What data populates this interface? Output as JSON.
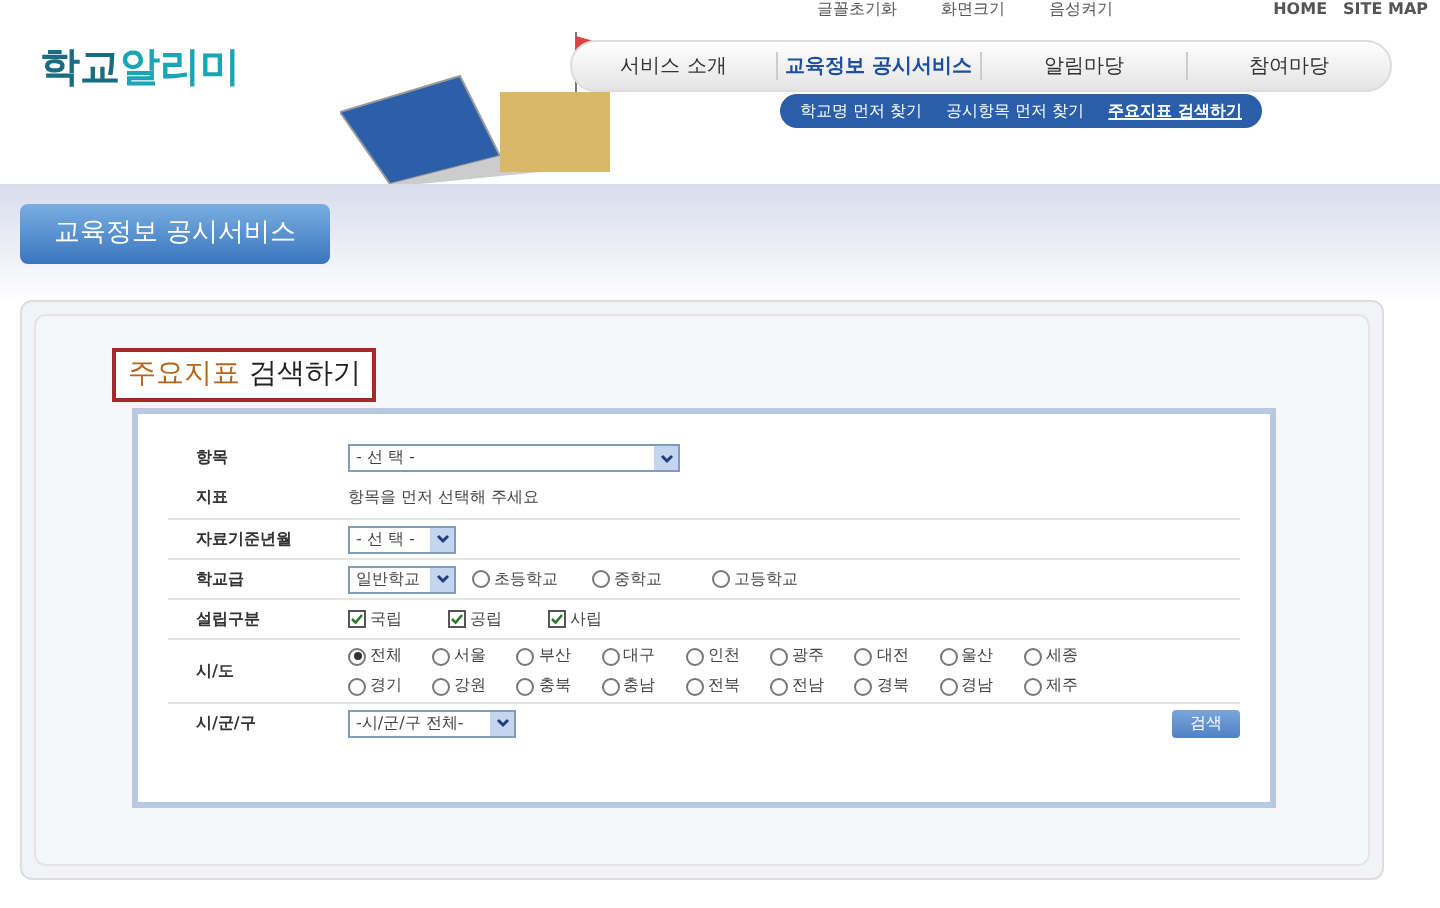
{
  "utility_links": [
    "글꼴초기화",
    "화면크기",
    "음성켜기"
  ],
  "top_links": [
    "HOME",
    "SITE MAP"
  ],
  "logo": {
    "part_1": "학교",
    "part_2": "알리미"
  },
  "main_nav": [
    {
      "label": "서비스 소개",
      "selected": false
    },
    {
      "label": "교육정보 공시서비스",
      "selected": true
    },
    {
      "label": "알림마당",
      "selected": false
    },
    {
      "label": "참여마당",
      "selected": false
    }
  ],
  "sub_nav": [
    {
      "label": "학교명 먼저 찾기",
      "selected": false
    },
    {
      "label": "공시항목 먼저 찾기",
      "selected": false
    },
    {
      "label": "주요지표 검색하기",
      "selected": true
    }
  ],
  "section_tab": "교육정보 공시서비스",
  "page_title": {
    "highlight": "주요지표",
    "rest": "검색하기"
  },
  "form": {
    "rows": [
      {
        "label": "항목",
        "kind": "select",
        "value": "- 선 택 -",
        "wide": true
      },
      {
        "label": "지표",
        "kind": "text",
        "text": "항목을 먼저 선택해 주세요"
      },
      {
        "label": "자료기준년월",
        "kind": "select",
        "value": "- 선 택 -",
        "wide": false
      },
      {
        "label": "학교급",
        "kind": "select_radios",
        "value": "일반학교",
        "options": [
          {
            "label": "초등학교",
            "selected": false
          },
          {
            "label": "중학교",
            "selected": false
          },
          {
            "label": "고등학교",
            "selected": false
          }
        ]
      },
      {
        "label": "설립구분",
        "kind": "checkboxes",
        "options": [
          {
            "label": "국립",
            "checked": true
          },
          {
            "label": "공립",
            "checked": true
          },
          {
            "label": "사립",
            "checked": true
          }
        ]
      },
      {
        "label": "시/도",
        "kind": "radios",
        "options": [
          {
            "label": "전체",
            "selected": true
          },
          {
            "label": "서울",
            "selected": false
          },
          {
            "label": "부산",
            "selected": false
          },
          {
            "label": "대구",
            "selected": false
          },
          {
            "label": "인천",
            "selected": false
          },
          {
            "label": "광주",
            "selected": false
          },
          {
            "label": "대전",
            "selected": false
          },
          {
            "label": "울산",
            "selected": false
          },
          {
            "label": "세종",
            "selected": false
          },
          {
            "label": "경기",
            "selected": false
          },
          {
            "label": "강원",
            "selected": false
          },
          {
            "label": "충북",
            "selected": false
          },
          {
            "label": "충남",
            "selected": false
          },
          {
            "label": "전북",
            "selected": false
          },
          {
            "label": "전남",
            "selected": false
          },
          {
            "label": "경북",
            "selected": false
          },
          {
            "label": "경남",
            "selected": false
          },
          {
            "label": "제주",
            "selected": false
          }
        ]
      },
      {
        "label": "시/군/구",
        "kind": "select_button",
        "value": "-시/군/구 전체-",
        "button": "검색"
      }
    ]
  }
}
